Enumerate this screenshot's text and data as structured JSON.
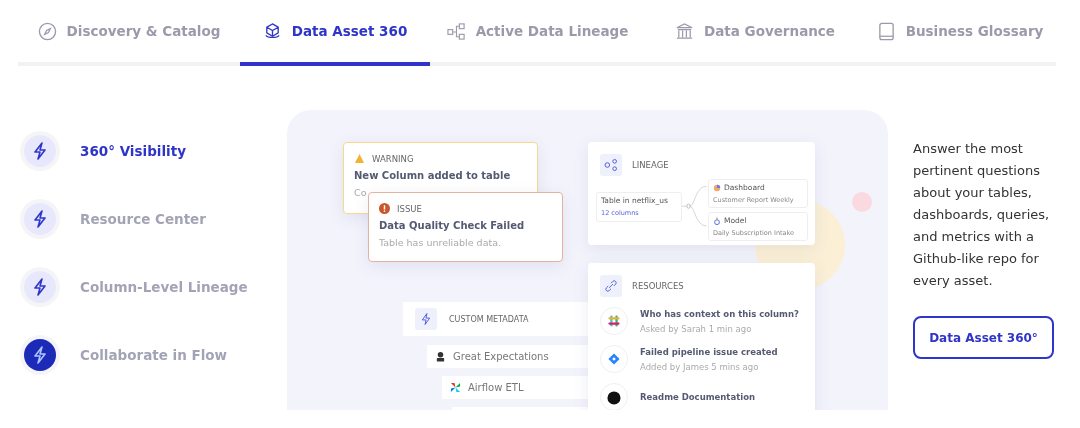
{
  "tabs": [
    {
      "label": "Discovery & Catalog",
      "selected": false
    },
    {
      "label": "Data Asset 360",
      "selected": true
    },
    {
      "label": "Active Data Lineage",
      "selected": false
    },
    {
      "label": "Data Governance",
      "selected": false
    },
    {
      "label": "Business Glossary",
      "selected": false
    }
  ],
  "features": [
    {
      "label": "360° Visibility",
      "selected": true,
      "icon_filled": false
    },
    {
      "label": "Resource Center",
      "selected": false,
      "icon_filled": false
    },
    {
      "label": "Column-Level Lineage",
      "selected": false,
      "icon_filled": false
    },
    {
      "label": "Collaborate in Flow",
      "selected": false,
      "icon_filled": true
    }
  ],
  "showcase": {
    "warning": {
      "tag": "WARNING",
      "title": "New Column added to table",
      "text": "Co"
    },
    "issue": {
      "tag": "ISSUE",
      "title": "Data Quality Check Failed",
      "text": "Table has unreliable data."
    },
    "lineage": {
      "title": "LINEAGE",
      "source": "Table in netflix_us",
      "columns": "12 columns",
      "targets": [
        {
          "kind": "dashboard",
          "title": "Dashboard",
          "subtitle": "Customer Report Weekly"
        },
        {
          "kind": "model",
          "title": "Model",
          "subtitle": "Daily Subscription Intake"
        }
      ]
    },
    "resources": {
      "title": "RESOURCES",
      "items": [
        {
          "kind": "slack",
          "title": "Who has context on this column?",
          "meta": "Asked by Sarah 1 min ago"
        },
        {
          "kind": "jira",
          "title": "Failed pipeline issue created",
          "meta": "Added by James 5 mins ago"
        },
        {
          "kind": "github",
          "title": "Readme Documentation"
        }
      ]
    },
    "metadata": {
      "title": "CUSTOM METADATA",
      "items": [
        {
          "kind": "expectations",
          "label": "Great Expectations"
        },
        {
          "kind": "airflow",
          "label": "Airflow ETL"
        }
      ]
    }
  },
  "description": "Answer the most pertinent questions about your tables, dashboards, queries, and metrics with a Github-like repo for every asset.",
  "cta": "Data Asset 360°"
}
